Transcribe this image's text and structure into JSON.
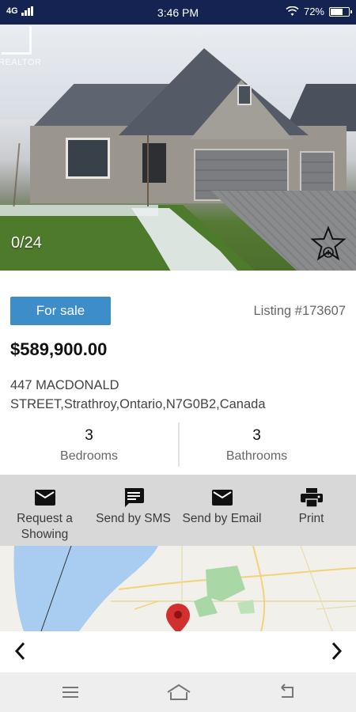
{
  "status_bar": {
    "network": "4G",
    "time": "3:46 PM",
    "battery": "72%",
    "battery_level": 0.72
  },
  "hero": {
    "logo_text": "REALTOR",
    "photo_counter": "0/24"
  },
  "listing": {
    "status_badge": "For sale",
    "listing_number": "Listing #173607",
    "price": "$589,900.00",
    "address_line1": "447 MACDONALD",
    "address_line2": "STREET,Strathroy,Ontario,N7G0B2,Canada",
    "bedrooms_count": "3",
    "bedrooms_label": "Bedrooms",
    "bathrooms_count": "3",
    "bathrooms_label": "Bathrooms"
  },
  "actions": [
    {
      "label_line1": "Request a",
      "label_line2": "Showing",
      "icon": "mail-icon"
    },
    {
      "label_line1": "Send by SMS",
      "label_line2": "",
      "icon": "sms-icon"
    },
    {
      "label_line1": "Send by Email",
      "label_line2": "",
      "icon": "mail-icon"
    },
    {
      "label_line1": "Print",
      "label_line2": "",
      "icon": "print-icon"
    }
  ],
  "colors": {
    "status_bar": "#142352",
    "badge": "#3e8dcb",
    "action_bar": "#d8d8d8",
    "map_pin": "#d32f2f"
  }
}
